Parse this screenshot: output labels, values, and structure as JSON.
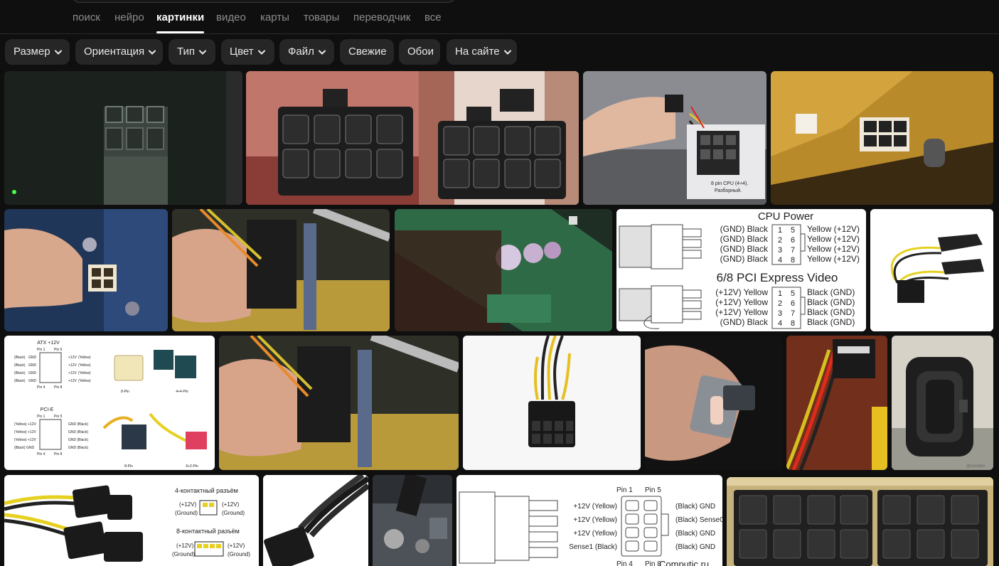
{
  "tabs": [
    {
      "label": "поиск"
    },
    {
      "label": "нейро"
    },
    {
      "label": "картинки",
      "active": true
    },
    {
      "label": "видео"
    },
    {
      "label": "карты"
    },
    {
      "label": "товары"
    },
    {
      "label": "переводчик"
    },
    {
      "label": "все"
    }
  ],
  "filters": [
    {
      "label": "Размер",
      "dropdown": true
    },
    {
      "label": "Ориентация",
      "dropdown": true
    },
    {
      "label": "Тип",
      "dropdown": true
    },
    {
      "label": "Цвет",
      "dropdown": true
    },
    {
      "label": "Файл",
      "dropdown": true
    },
    {
      "label": "Свежие",
      "dropdown": false
    },
    {
      "label": "Обои",
      "dropdown": false
    },
    {
      "label": "На сайте",
      "dropdown": true
    }
  ],
  "results": {
    "photo3_caption_1": "8 pin CPU (4+4).",
    "photo3_caption_2": "Разборный.",
    "cpu_power": {
      "title": "CPU Power",
      "left": [
        "(GND) Black",
        "(GND) Black",
        "(GND) Black",
        "(GND) Black"
      ],
      "pins": [
        [
          "1",
          "5"
        ],
        [
          "2",
          "6"
        ],
        [
          "3",
          "7"
        ],
        [
          "4",
          "8"
        ]
      ],
      "right": [
        "Yellow (+12V)",
        "Yellow (+12V)",
        "Yellow (+12V)",
        "Yellow (+12V)"
      ]
    },
    "pci_express": {
      "title": "6/8 PCI Express Video",
      "left": [
        "(+12V) Yellow",
        "(+12V) Yellow",
        "(+12V) Yellow",
        "(GND) Black"
      ],
      "pins": [
        [
          "1",
          "5"
        ],
        [
          "2",
          "6"
        ],
        [
          "3",
          "7"
        ],
        [
          "4",
          "8"
        ]
      ],
      "right": [
        "Black (GND)",
        "Black (GND)",
        "Black (GND)",
        "Black (GND)"
      ]
    },
    "atx_diagram": {
      "atx_title": "ATX +12V",
      "pin1": "Pin 1",
      "pin5": "Pin 5",
      "atx_left": [
        "(Black)",
        "(Black)",
        "(Black)",
        "(Black)"
      ],
      "atx_gnd": [
        "GND",
        "GND",
        "GND",
        "GND"
      ],
      "atx_right_v": [
        "+12V",
        "+12V",
        "+12V",
        "+12V"
      ],
      "atx_right_c": [
        "(Yellow)",
        "(Yellow)",
        "(Yellow)",
        "(Yellow)"
      ],
      "pin4": "Pin 4",
      "pin8": "Pin 8",
      "pcie_title": "PCI-E",
      "pin1b": "Pin 1",
      "pin5b": "Pin 5",
      "pcie_left": [
        "(Yellow) +12V",
        "(Yellow) +12V",
        "(Yellow) +12V",
        "(Black) GND"
      ],
      "pcie_right": [
        "GND (Black)",
        "GND (Black)",
        "GND (Black)",
        "GND (Black)"
      ],
      "pin4b": "Pin 4",
      "pin8b": "Pin 8",
      "label_8pin": "8-Pin",
      "label_44pin": "4+4-Pin",
      "label_8pinb": "8-Pin",
      "label_62pin": "6+2-Pin"
    },
    "watermark": "@smolkin",
    "connector_ru": {
      "title4": "4-контактный разъём",
      "left4_v": "(+12V)",
      "left4_g": "(Ground)",
      "right4_v": "(+12V)",
      "right4_g": "(Ground)",
      "title8": "8-контактный разъём",
      "left8_v": "(+12V)",
      "left8_g": "(Ground)",
      "right8_v": "(+12V)",
      "right8_g": "(Ground)"
    },
    "sense_diagram": {
      "pin1": "Pin 1",
      "pin5": "Pin 5",
      "left": [
        "+12V (Yellow)",
        "+12V (Yellow)",
        "+12V (Yellow)",
        "Sense1 (Black)"
      ],
      "right": [
        "(Black) GND",
        "(Black) Sense0",
        "(Black) GND",
        "(Black) GND"
      ],
      "pin4": "Pin 4",
      "pin8": "Pin 8",
      "brand": "Computic.ru"
    }
  }
}
